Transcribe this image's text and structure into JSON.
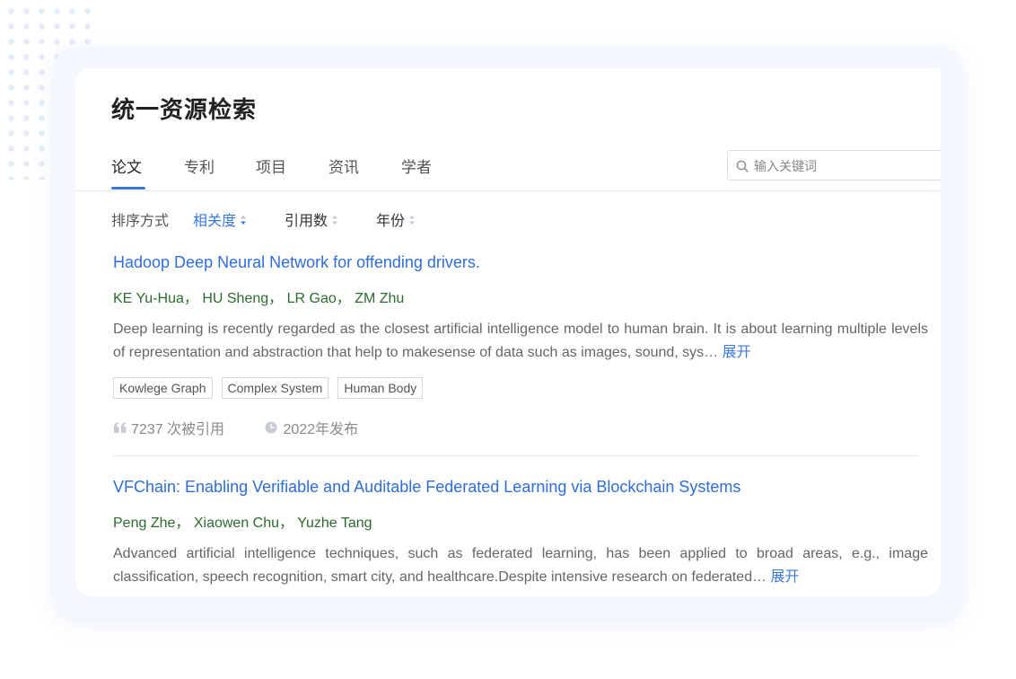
{
  "page": {
    "title": "统一资源检索"
  },
  "tabs": [
    {
      "label": "论文",
      "active": true
    },
    {
      "label": "专利",
      "active": false
    },
    {
      "label": "项目",
      "active": false
    },
    {
      "label": "资讯",
      "active": false
    },
    {
      "label": "学者",
      "active": false
    }
  ],
  "search": {
    "placeholder": "输入关键词",
    "value": ""
  },
  "sort": {
    "label": "排序方式",
    "options": [
      {
        "label": "相关度",
        "active": true
      },
      {
        "label": "引用数",
        "active": false
      },
      {
        "label": "年份",
        "active": false
      }
    ]
  },
  "papers": [
    {
      "title": "Hadoop Deep Neural Network for offending drivers.",
      "authors": [
        "KE Yu-Hua",
        "HU Sheng",
        "LR Gao",
        "ZM Zhu"
      ],
      "abstract": "Deep learning is recently regarded as the closest artificial intelligence model to human brain. It is about learning multiple levels of representation and abstraction that help to makesense of data such as images, sound, sys…",
      "expand": "展开",
      "tags": [
        "Kowlege Graph",
        "Complex System",
        "Human Body"
      ],
      "citations": "7237 次被引用",
      "published": "2022年发布"
    },
    {
      "title": "VFChain: Enabling Verifiable and Auditable Federated Learning via Blockchain Systems",
      "authors": [
        "Peng Zhe",
        "Xiaowen Chu",
        "Yuzhe Tang"
      ],
      "abstract": "Advanced artificial intelligence techniques, such as federated learning, has been applied to broad areas, e.g., image classification, speech recognition, smart city, and healthcare.Despite intensive research on federated…",
      "expand": "展开"
    }
  ],
  "colors": {
    "accent": "#3a78e0",
    "title_link": "#2f6ed5",
    "author_green": "#2d6a2d",
    "frame_bg": "#f4f8fe"
  }
}
